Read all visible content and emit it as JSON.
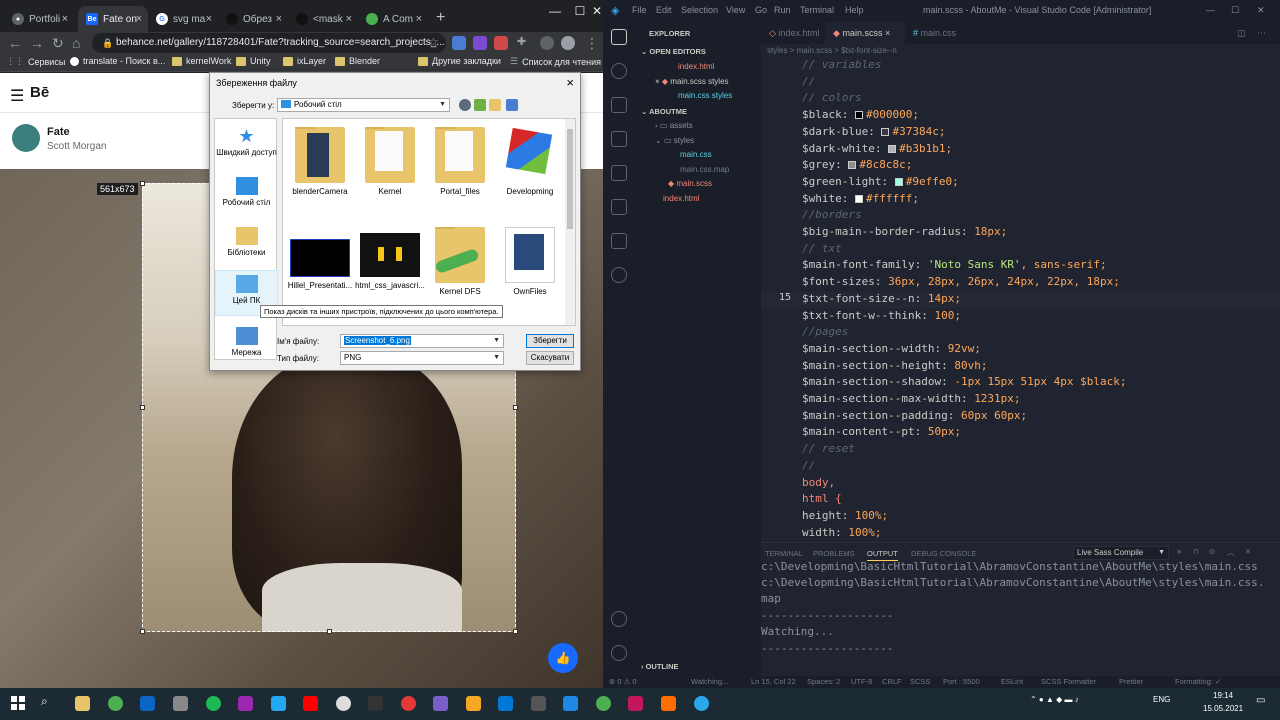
{
  "browser": {
    "tabs": [
      {
        "label": "Portfoli",
        "icon": "github-icon"
      },
      {
        "label": "Fate on",
        "icon": "behance-icon"
      },
      {
        "label": "svg ma",
        "icon": "google-icon"
      },
      {
        "label": "Обрез",
        "icon": "masked-icon"
      },
      {
        "label": "<mask",
        "icon": "masked-icon"
      },
      {
        "label": "A Com",
        "icon": "leaf-icon"
      }
    ],
    "url": "behance.net/gallery/118728401/Fate?tracking_source=search_projects_...",
    "bookmarks": [
      "Сервисы",
      "translate - Поиск в...",
      "kernelWork",
      "Unity",
      "ixLayer",
      "Blender",
      "Другие закладки",
      "Список для чтения"
    ]
  },
  "behance": {
    "logo": "Bē",
    "project_title": "Fate",
    "author": "Scott Morgan",
    "selection_size": "561x673",
    "appreciate_icon": "👍"
  },
  "dialog": {
    "title": "Збереження файлу",
    "save_in_label": "Зберегти у:",
    "save_in_value": "Робочий стіл",
    "places": [
      "Швидкий доступ",
      "Робочий стіл",
      "Бібліотеки",
      "Цей ПК",
      "Мережа"
    ],
    "files": [
      "blenderCamera",
      "Kernel",
      "Portal_files",
      "Developming",
      "Hillel_Presentati...",
      "html_css_javascri...",
      "Kernel DFS",
      "OwnFiles"
    ],
    "tooltip": "Показ дисків та інших пристроїв, підключених до цього комп'ютера.",
    "filename_label": "Ім'я файлу:",
    "filename_value": "Screenshot_6.png",
    "filetype_label": "Тип файлу:",
    "filetype_value": "PNG",
    "save_button": "Зберегти",
    "cancel_button": "Скасувати",
    "close": "×"
  },
  "vscode": {
    "menu": [
      "File",
      "Edit",
      "Selection",
      "View",
      "Go",
      "Run",
      "Terminal",
      "Help"
    ],
    "window_title": "main.scss - AboutMe - Visual Studio Code [Administrator]",
    "explorer_title": "EXPLORER",
    "open_editors_title": "OPEN EDITORS",
    "open_editors": [
      "index.html",
      "main.scss styles",
      "main.css styles"
    ],
    "project_title": "ABOUTME",
    "tree": [
      "assets",
      "styles",
      "main.css",
      "main.css.map",
      "main.scss",
      "index.html"
    ],
    "outline": "OUTLINE",
    "tabs": [
      "index.html",
      "main.scss",
      "main.css"
    ],
    "breadcrumbs": "styles  >  main.scss  >  $txt-font-size--n",
    "lines": [
      {
        "n": "",
        "text": "// variables"
      },
      {
        "n": "",
        "text": "//"
      },
      {
        "n": "",
        "text": "// colors"
      },
      {
        "n": "",
        "var": "$black:",
        "swatch": "#000000",
        "val": "#000000;"
      },
      {
        "n": "",
        "var": "$dark-blue:",
        "swatch": "#37384c",
        "val": "#37384c;"
      },
      {
        "n": "",
        "var": "$dark-white:",
        "swatch": "#b3b1b1",
        "val": "#b3b1b1;"
      },
      {
        "n": "",
        "var": "$grey:",
        "swatch": "#8c8c8c",
        "val": "#8c8c8c;"
      },
      {
        "n": "",
        "var": "$green-light:",
        "swatch": "#9effe0",
        "val": "#9effe0;"
      },
      {
        "n": "",
        "var": "$white:",
        "swatch": "#ffffff",
        "val": "#ffffff;"
      },
      {
        "n": "",
        "text": "//borders"
      },
      {
        "n": "",
        "var": "$big-main--border-radius:",
        "val": "18px;"
      },
      {
        "n": "",
        "text": "// txt"
      },
      {
        "n": "",
        "var": "$main-font-family:",
        "str": "'Noto Sans KR'",
        "val": ", sans-serif;"
      },
      {
        "n": "",
        "var": "$font-sizes:",
        "val": "36px, 28px, 26px, 24px, 22px, 18px;"
      },
      {
        "n": "15",
        "var": "$txt-font-size--n:",
        "val": "14px;"
      },
      {
        "n": "",
        "var": "$txt-font-w--think:",
        "val": "100;"
      },
      {
        "n": "",
        "text": "//pages"
      },
      {
        "n": "",
        "var": "$main-section--width:",
        "val": "92vw;"
      },
      {
        "n": "",
        "var": "$main-section--height:",
        "val": "80vh;"
      },
      {
        "n": "",
        "var": "$main-section--shadow:",
        "val": "-1px 15px 51px 4px $black;"
      },
      {
        "n": "",
        "var": "$main-section--max-width:",
        "val": "1231px;"
      },
      {
        "n": "",
        "var": "$main-section--padding:",
        "val": "60px 60px;"
      },
      {
        "n": "",
        "var": "$main-content--pt:",
        "val": "50px;"
      },
      {
        "n": "",
        "text": "// reset"
      },
      {
        "n": "",
        "text": "//"
      },
      {
        "n": "",
        "kw": "body,"
      },
      {
        "n": "",
        "kw": "html {"
      },
      {
        "n": "",
        "var": "  height:",
        "val": "100%;"
      },
      {
        "n": "",
        "var": "  width:",
        "val": "100%;"
      }
    ],
    "panel_tabs": [
      "TERMINAL",
      "PROBLEMS",
      "OUTPUT",
      "DEBUG CONSOLE"
    ],
    "output_channel": "Live Sass Compile",
    "output_lines": [
      "c:\\Developming\\BasicHtmlTutorial\\AbramovConstantine\\AboutMe\\styles\\main.css",
      "c:\\Developming\\BasicHtmlTutorial\\AbramovConstantine\\AboutMe\\styles\\main.css.",
      "map",
      "--------------------",
      "Watching...",
      "--------------------"
    ],
    "status": {
      "watching": "Watching...",
      "position": "Ln 15, Col 22",
      "spaces": "Spaces: 2",
      "encoding": "UTF-8",
      "eol": "CRLF",
      "language": "SCSS",
      "port": "Port : 5500",
      "eslint": "ESLint",
      "formatter": "SCSS Formatter",
      "prettier": "Prettier",
      "formatting": "Formatting: ✓"
    }
  },
  "taskbar": {
    "lang": "ENG",
    "time": "19:14",
    "date": "15.05.2021"
  }
}
